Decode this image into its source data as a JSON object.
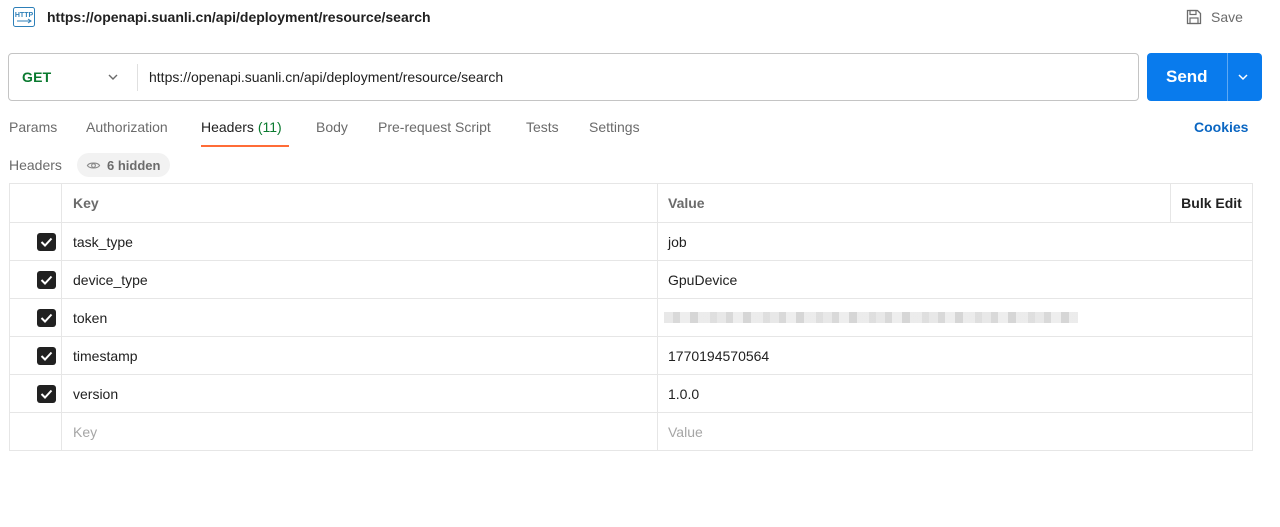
{
  "titlebar": {
    "icon": "http-icon",
    "title": "https://openapi.suanli.cn/api/deployment/resource/search",
    "save_label": "Save"
  },
  "request": {
    "method": "GET",
    "url": "https://openapi.suanli.cn/api/deployment/resource/search",
    "send_label": "Send"
  },
  "tabs": [
    {
      "label": "Params"
    },
    {
      "label": "Authorization"
    },
    {
      "label": "Headers",
      "count": "(11)",
      "active": true
    },
    {
      "label": "Body"
    },
    {
      "label": "Pre-request Script"
    },
    {
      "label": "Tests"
    },
    {
      "label": "Settings"
    }
  ],
  "cookies_label": "Cookies",
  "headers_section": {
    "label": "Headers",
    "hidden_label": "6 hidden"
  },
  "table": {
    "columns": {
      "key": "Key",
      "value": "Value",
      "bulk_edit": "Bulk Edit"
    },
    "rows": [
      {
        "key": "task_type",
        "value": "job",
        "checked": true
      },
      {
        "key": "device_type",
        "value": "GpuDevice",
        "checked": true
      },
      {
        "key": "token",
        "value": "",
        "checked": true,
        "redacted": true
      },
      {
        "key": "timestamp",
        "value": "1770194570564",
        "checked": true
      },
      {
        "key": "version",
        "value": "1.0.0",
        "checked": true
      }
    ],
    "new_row": {
      "key_placeholder": "Key",
      "value_placeholder": "Value"
    }
  },
  "colors": {
    "method_get": "#0a7a2f",
    "send_button": "#097bed",
    "active_tab_underline": "#ff6c37",
    "cookies_link": "#0a66c2"
  }
}
